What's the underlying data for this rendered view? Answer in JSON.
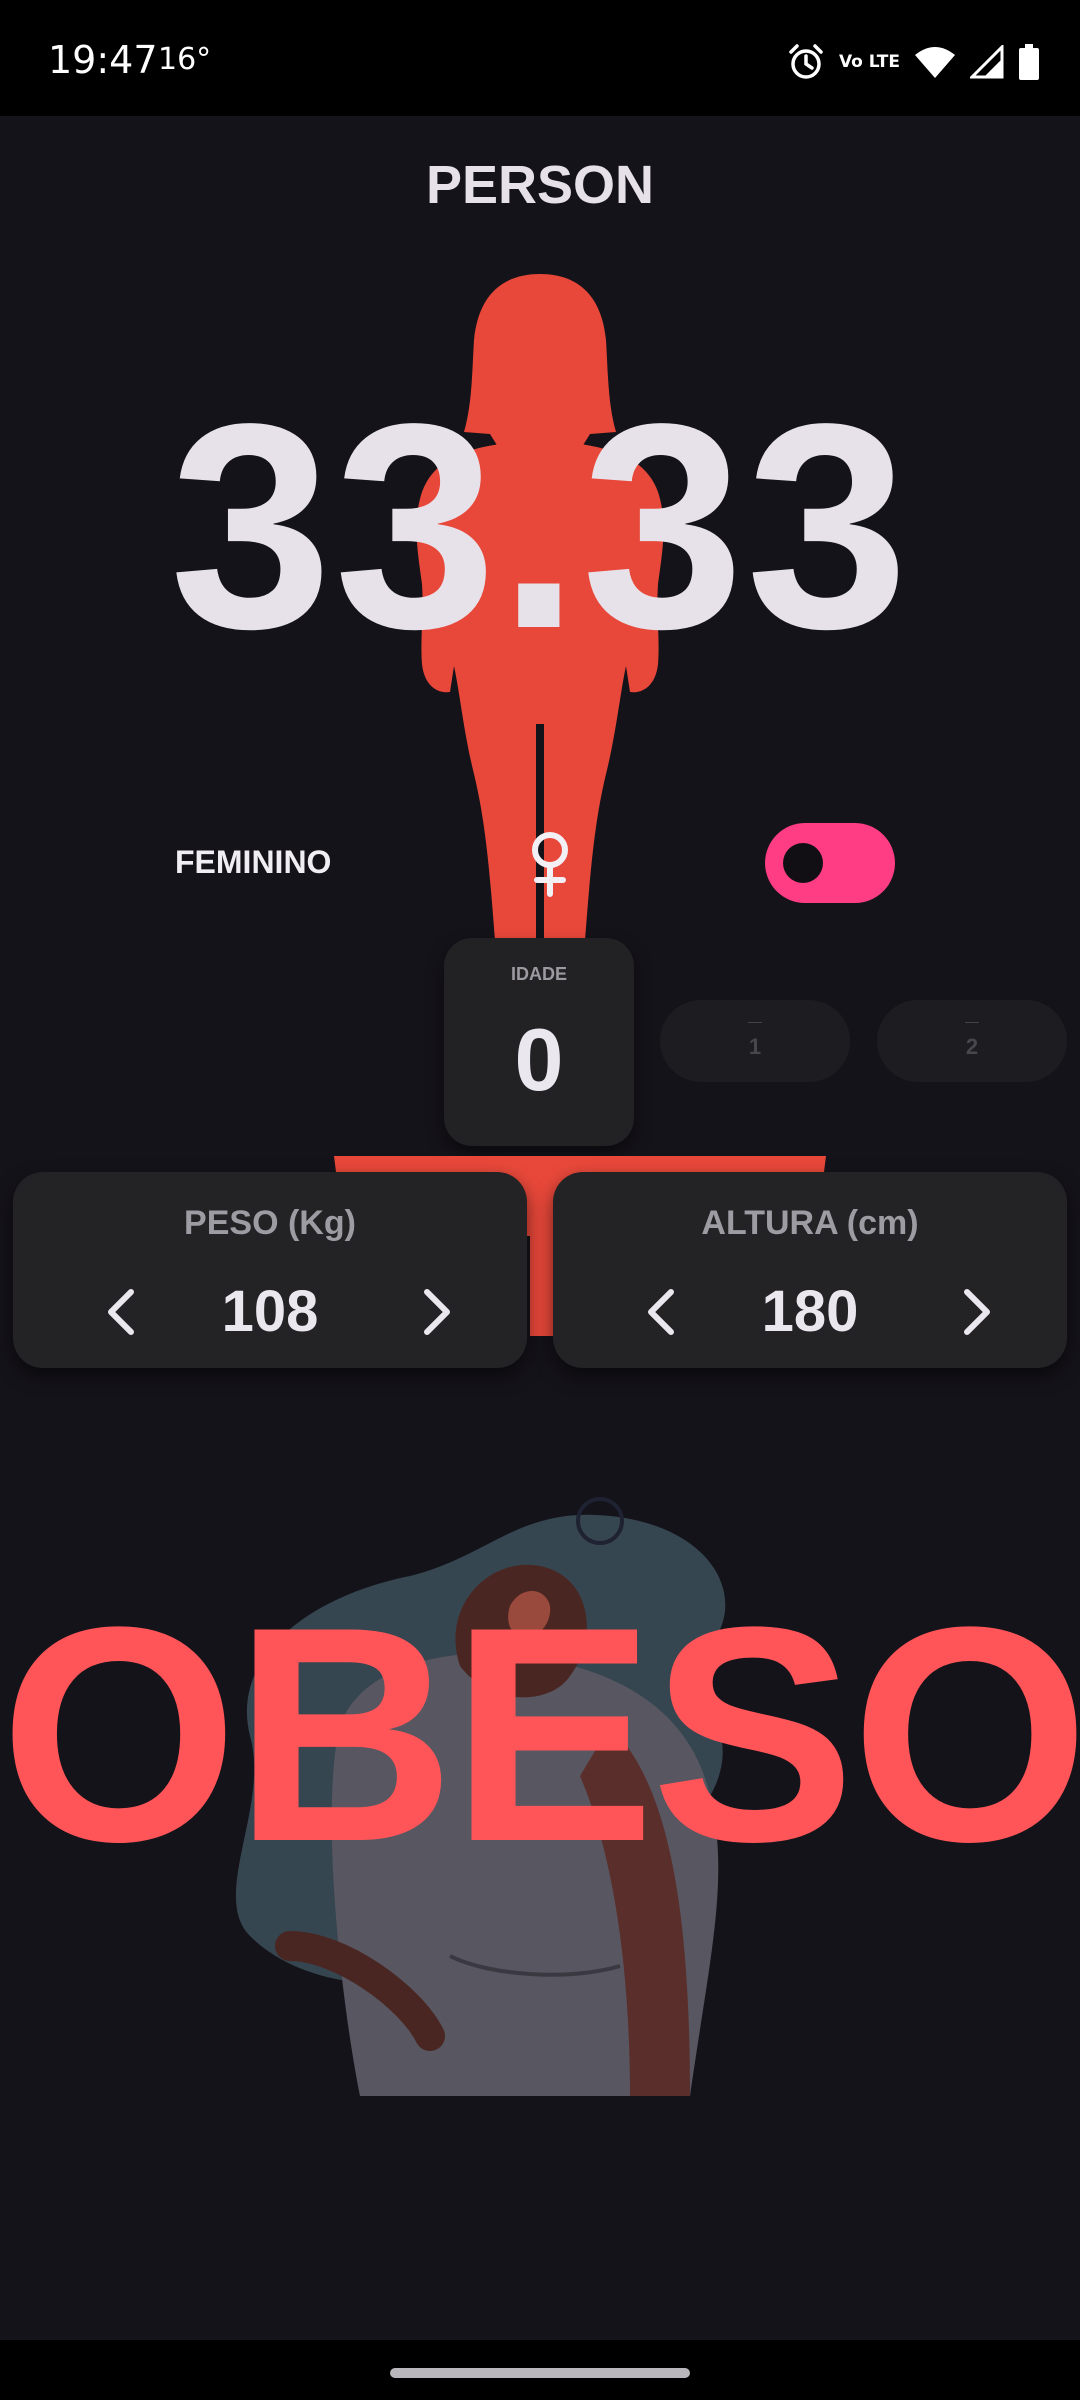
{
  "status_bar": {
    "time": "19:47",
    "temperature": "16°",
    "network_label": "Vo LTE"
  },
  "app": {
    "title": "PERSON"
  },
  "result": {
    "bmi": "33.33",
    "category": "OBESO",
    "category_color": "#ff5558"
  },
  "gender": {
    "label": "FEMININO",
    "symbol": "♀",
    "toggle_on": true,
    "toggle_color": "#ff3d84"
  },
  "age": {
    "label": "IDADE",
    "value": "0",
    "next_options": [
      "1",
      "2"
    ]
  },
  "weight": {
    "label": "PESO (Kg)",
    "value": "108"
  },
  "height": {
    "label": "ALTURA (cm)",
    "value": "180"
  },
  "colors": {
    "background": "#15131a",
    "silhouette": "#e8483a",
    "card": "#232225"
  },
  "icons": {
    "alarm": "alarm-icon",
    "wifi": "wifi-icon",
    "signal": "signal-icon",
    "battery": "battery-icon",
    "female": "female-icon",
    "decrease": "chevron-left-icon",
    "increase": "chevron-right-icon"
  }
}
